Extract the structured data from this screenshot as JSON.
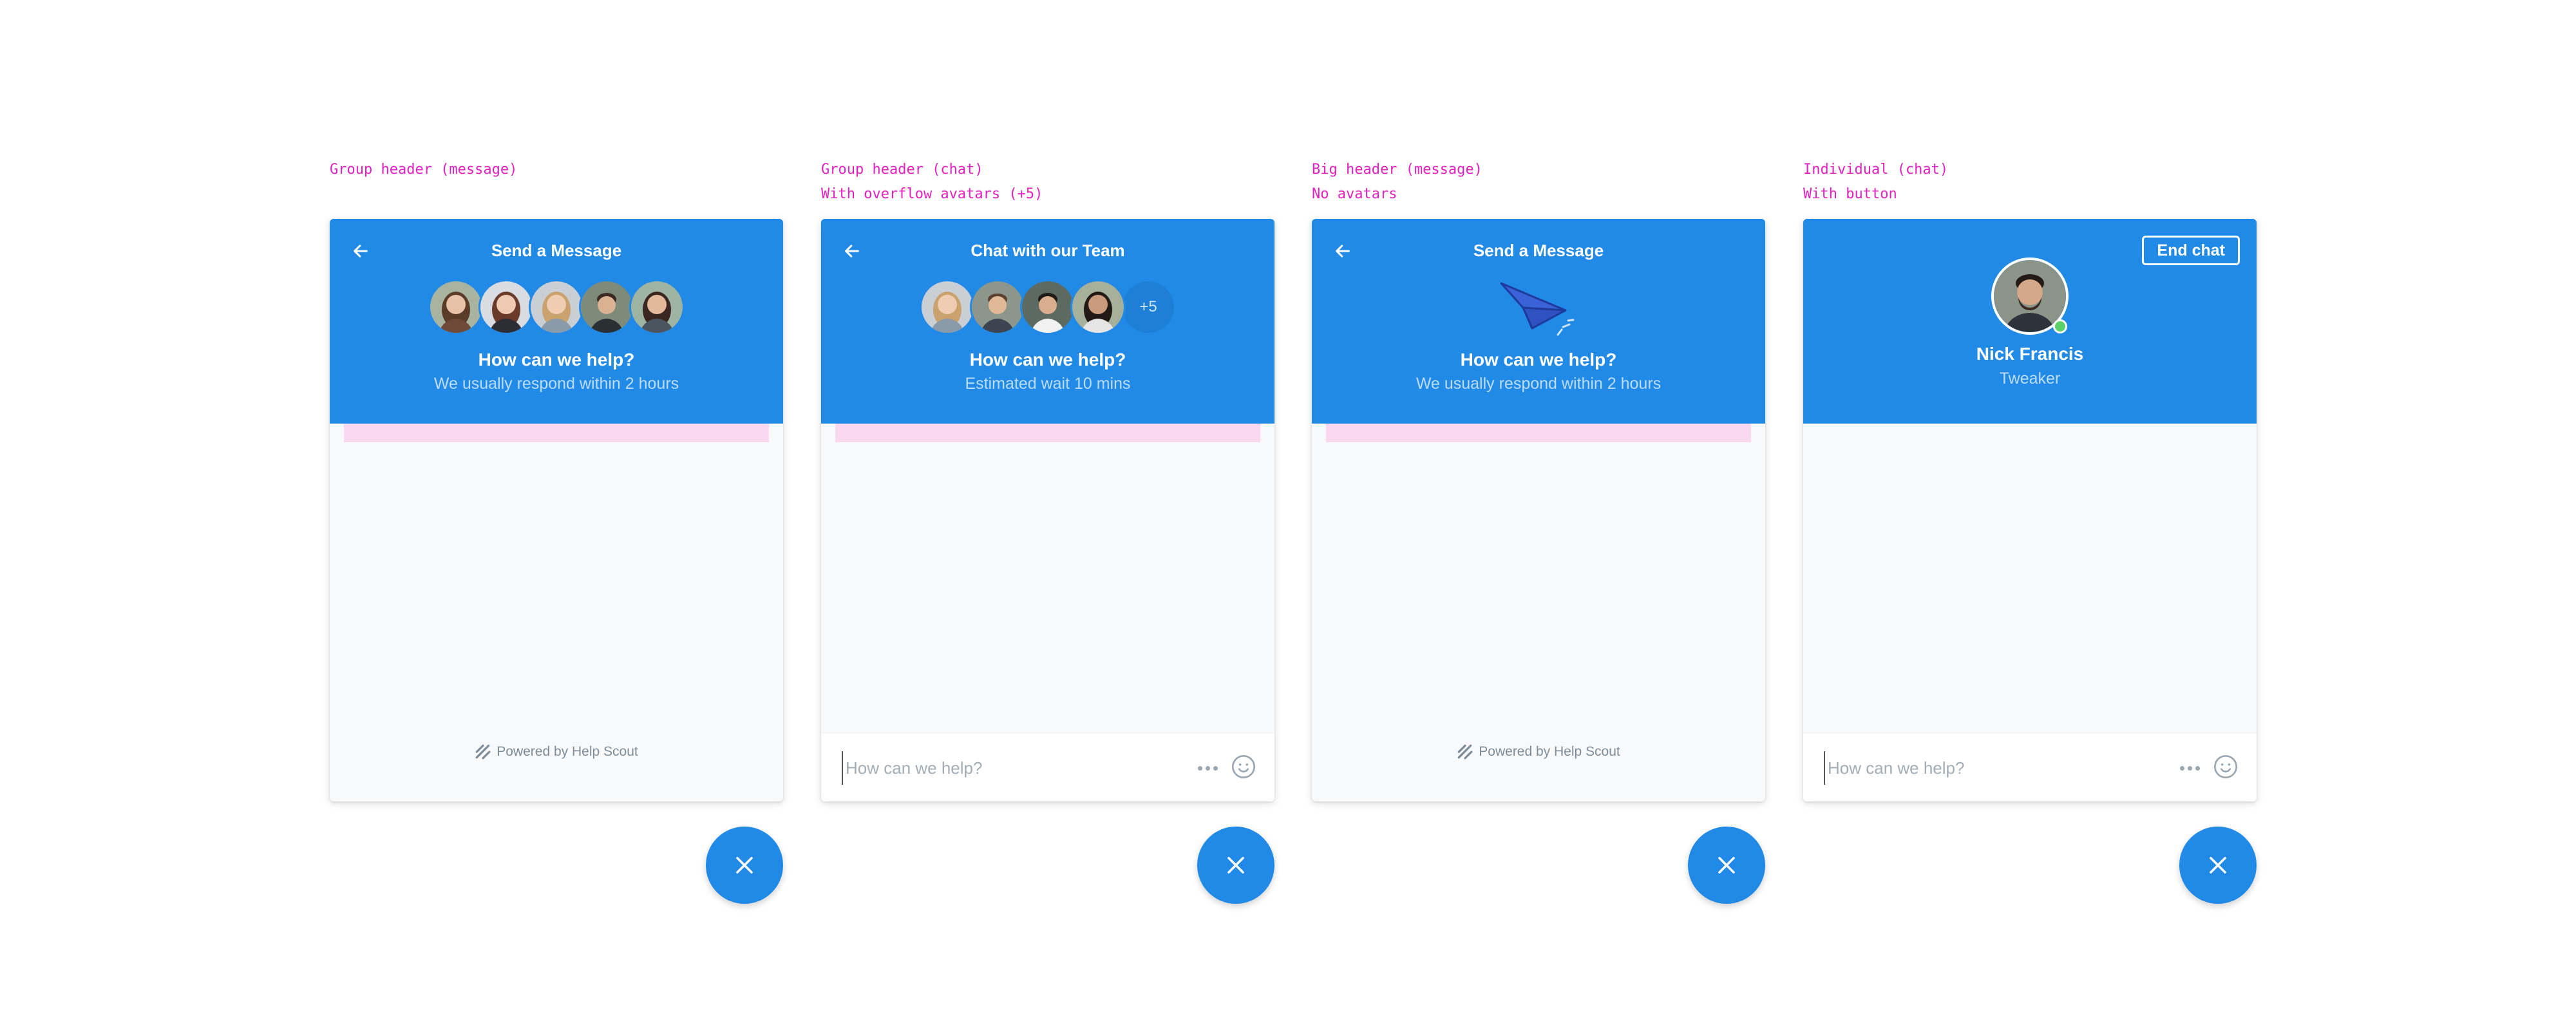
{
  "colors": {
    "header_blue": "#218ae6",
    "caption_magenta": "#e020c0",
    "pink_bar": "#fad8ef",
    "online_green": "#5bd16a",
    "body_bg": "#f8f9fa"
  },
  "panels": [
    {
      "caption_line1": "Group header (message)",
      "caption_line2": "",
      "back_icon": "arrow-left-icon",
      "title": "Send a Message",
      "question": "How can we help?",
      "subtitle": "We usually respond within 2 hours",
      "footer": "Powered by Help Scout"
    },
    {
      "caption_line1": "Group header (chat)",
      "caption_line2": "With overflow avatars (+5)",
      "back_icon": "arrow-left-icon",
      "title": "Chat with our Team",
      "overflow": "+5",
      "question": "How can we help?",
      "subtitle": "Estimated wait 10 mins",
      "input_placeholder": "How can we help?"
    },
    {
      "caption_line1": "Big header (message)",
      "caption_line2": "No avatars",
      "back_icon": "arrow-left-icon",
      "title": "Send a Message",
      "illustration": "paper-plane-icon",
      "question": "How can we help?",
      "subtitle": "We usually respond within 2 hours",
      "footer": "Powered by Help Scout"
    },
    {
      "caption_line1": "Individual (chat)",
      "caption_line2": "With button",
      "end_button": "End chat",
      "agent_name": "Nick Francis",
      "agent_role": "Tweaker",
      "input_placeholder": "How can we help?"
    }
  ]
}
